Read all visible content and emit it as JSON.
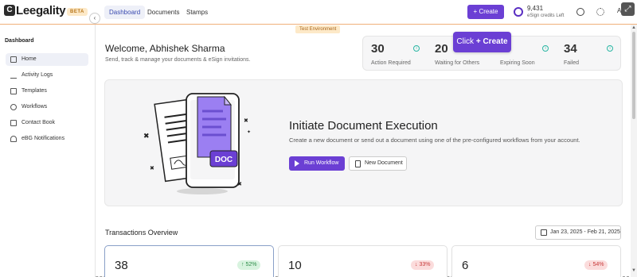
{
  "topbar": {
    "logo_mark": "C",
    "logo_text": "Leegality",
    "beta": "BETA",
    "nav": [
      {
        "label": "Dashboard"
      },
      {
        "label": "Documents"
      },
      {
        "label": "Stamps"
      }
    ],
    "create_label": "+ Create",
    "credits_value": "9,431",
    "credits_label": "eSign credits Left",
    "avatar_initial": "A",
    "expand_icon": "⤢"
  },
  "test_env": "Test Environment",
  "sidebar": {
    "title": "Dashboard",
    "toggle": "‹",
    "items": [
      {
        "label": "Home",
        "icon": "home-icon"
      },
      {
        "label": "Activity Logs",
        "icon": "activity-icon"
      },
      {
        "label": "Templates",
        "icon": "templates-icon"
      },
      {
        "label": "Workflows",
        "icon": "workflows-icon"
      },
      {
        "label": "Contact Book",
        "icon": "contact-book-icon"
      },
      {
        "label": "eBG Notifications",
        "icon": "bell-icon"
      }
    ]
  },
  "welcome": {
    "title": "Welcome, Abhishek Sharma",
    "subtitle": "Send, track & manage your documents & eSign invitations."
  },
  "stats": [
    {
      "value": "30",
      "label": "Action Required"
    },
    {
      "value": "20",
      "label": "Waiting for Others"
    },
    {
      "value": "",
      "label": "Expiring Soon"
    },
    {
      "value": "34",
      "label": "Failed"
    }
  ],
  "tooltip": {
    "prefix": "Click ",
    "action": "+ Create"
  },
  "hero": {
    "doc_label": "DOC",
    "title": "Initiate Document Execution",
    "description": "Create a new document or send out a document using one of the pre-configured workflows from your account.",
    "run_workflow": "Run Workflow",
    "new_document": "New Document"
  },
  "transactions": {
    "title": "Transactions Overview",
    "date_range": "Jan 23, 2025 - Feb 21, 2025",
    "cards": [
      {
        "value": "38",
        "change": "↑ 52%",
        "direction": "up"
      },
      {
        "value": "10",
        "change": "↓ 33%",
        "direction": "down"
      },
      {
        "value": "6",
        "change": "↓ 54%",
        "direction": "down"
      }
    ]
  },
  "colors": {
    "brand": "#6b3fd4",
    "teal": "#2ab6a3"
  }
}
